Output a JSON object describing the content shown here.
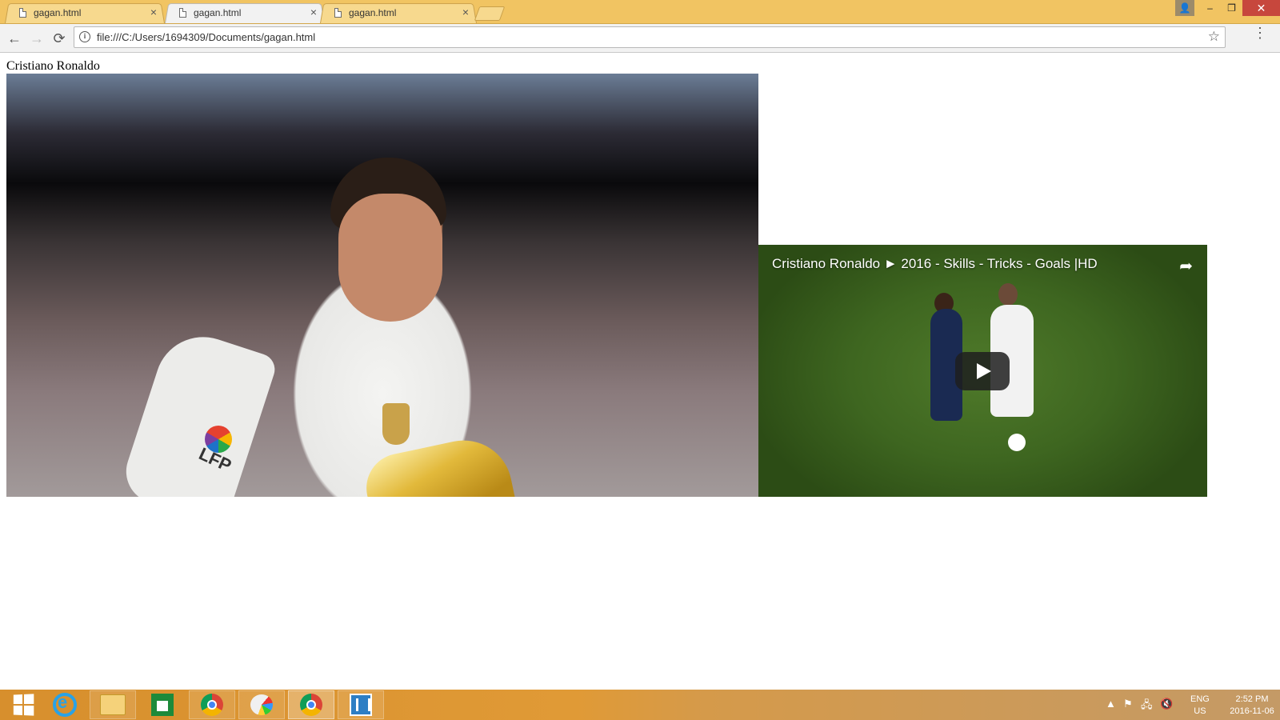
{
  "browser": {
    "tabs": [
      {
        "label": "gagan.html",
        "close": "×"
      },
      {
        "label": "gagan.html",
        "close": "×"
      },
      {
        "label": "gagan.html",
        "close": "×"
      }
    ],
    "active_tab_index": 1,
    "url": "file:///C:/Users/1694309/Documents/gagan.html",
    "window_buttons": {
      "minimize": "–",
      "restore": "❐",
      "close": "✕",
      "user": "👤"
    },
    "nav": {
      "back": "←",
      "forward": "→",
      "reload": "⟳",
      "star": "☆",
      "menu": "⋮",
      "info": "i"
    }
  },
  "page": {
    "title": "Cristiano Ronaldo",
    "photo": {
      "lfp_text": "LFP"
    },
    "video": {
      "title": "Cristiano Ronaldo ► 2016 - Skills - Tricks - Goals |HD",
      "share_icon": "➦"
    }
  },
  "taskbar": {
    "lang_line1": "ENG",
    "lang_line2": "US",
    "time": "2:52 PM",
    "date": "2016-11-06",
    "tray_icons": [
      "▲",
      "⚑",
      "🖧",
      "🔇"
    ]
  }
}
